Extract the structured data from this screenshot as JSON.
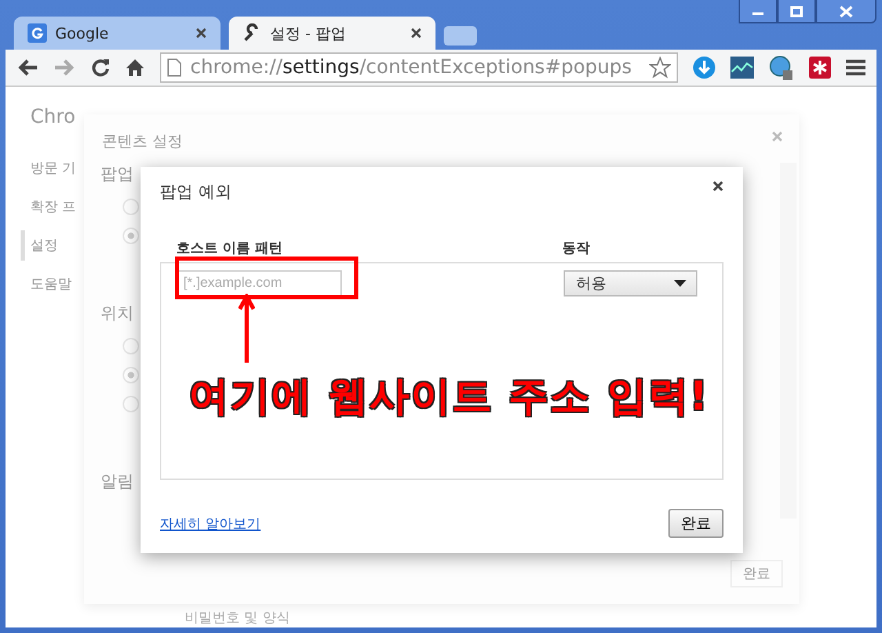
{
  "tabs": [
    {
      "title": "Google",
      "selected": false
    },
    {
      "title": "설정 - 팝업",
      "selected": true
    }
  ],
  "address": {
    "scheme": "chrome://",
    "host": "settings",
    "path": "/contentExceptions#popups"
  },
  "background_page": {
    "title": "Chro",
    "sidebar": [
      {
        "label": "방문 기",
        "selected": false
      },
      {
        "label": "확장 프",
        "selected": false
      },
      {
        "label": "설정",
        "selected": true
      },
      {
        "label": "도움말",
        "selected": false
      }
    ],
    "footer": "비밀번호 및 양식"
  },
  "content_settings": {
    "title": "콘텐츠 설정",
    "sections": [
      {
        "heading": "팝업",
        "radios": [
          {
            "selected": false
          },
          {
            "selected": true
          }
        ]
      },
      {
        "heading": "위치",
        "radios": [
          {
            "selected": false
          },
          {
            "selected": true
          },
          {
            "selected": false
          }
        ]
      },
      {
        "heading": "알림"
      }
    ],
    "done": "완료"
  },
  "dialog": {
    "title": "팝업 예외",
    "columns": [
      "호스트 이름 패턴",
      "동작"
    ],
    "rows": [
      {
        "placeholder": "[*.]example.com",
        "action": "허용"
      }
    ],
    "link": "자세히 알아보기",
    "done": "완료"
  },
  "annotation": {
    "text": "여기에 웹사이트 주소 입력!"
  }
}
